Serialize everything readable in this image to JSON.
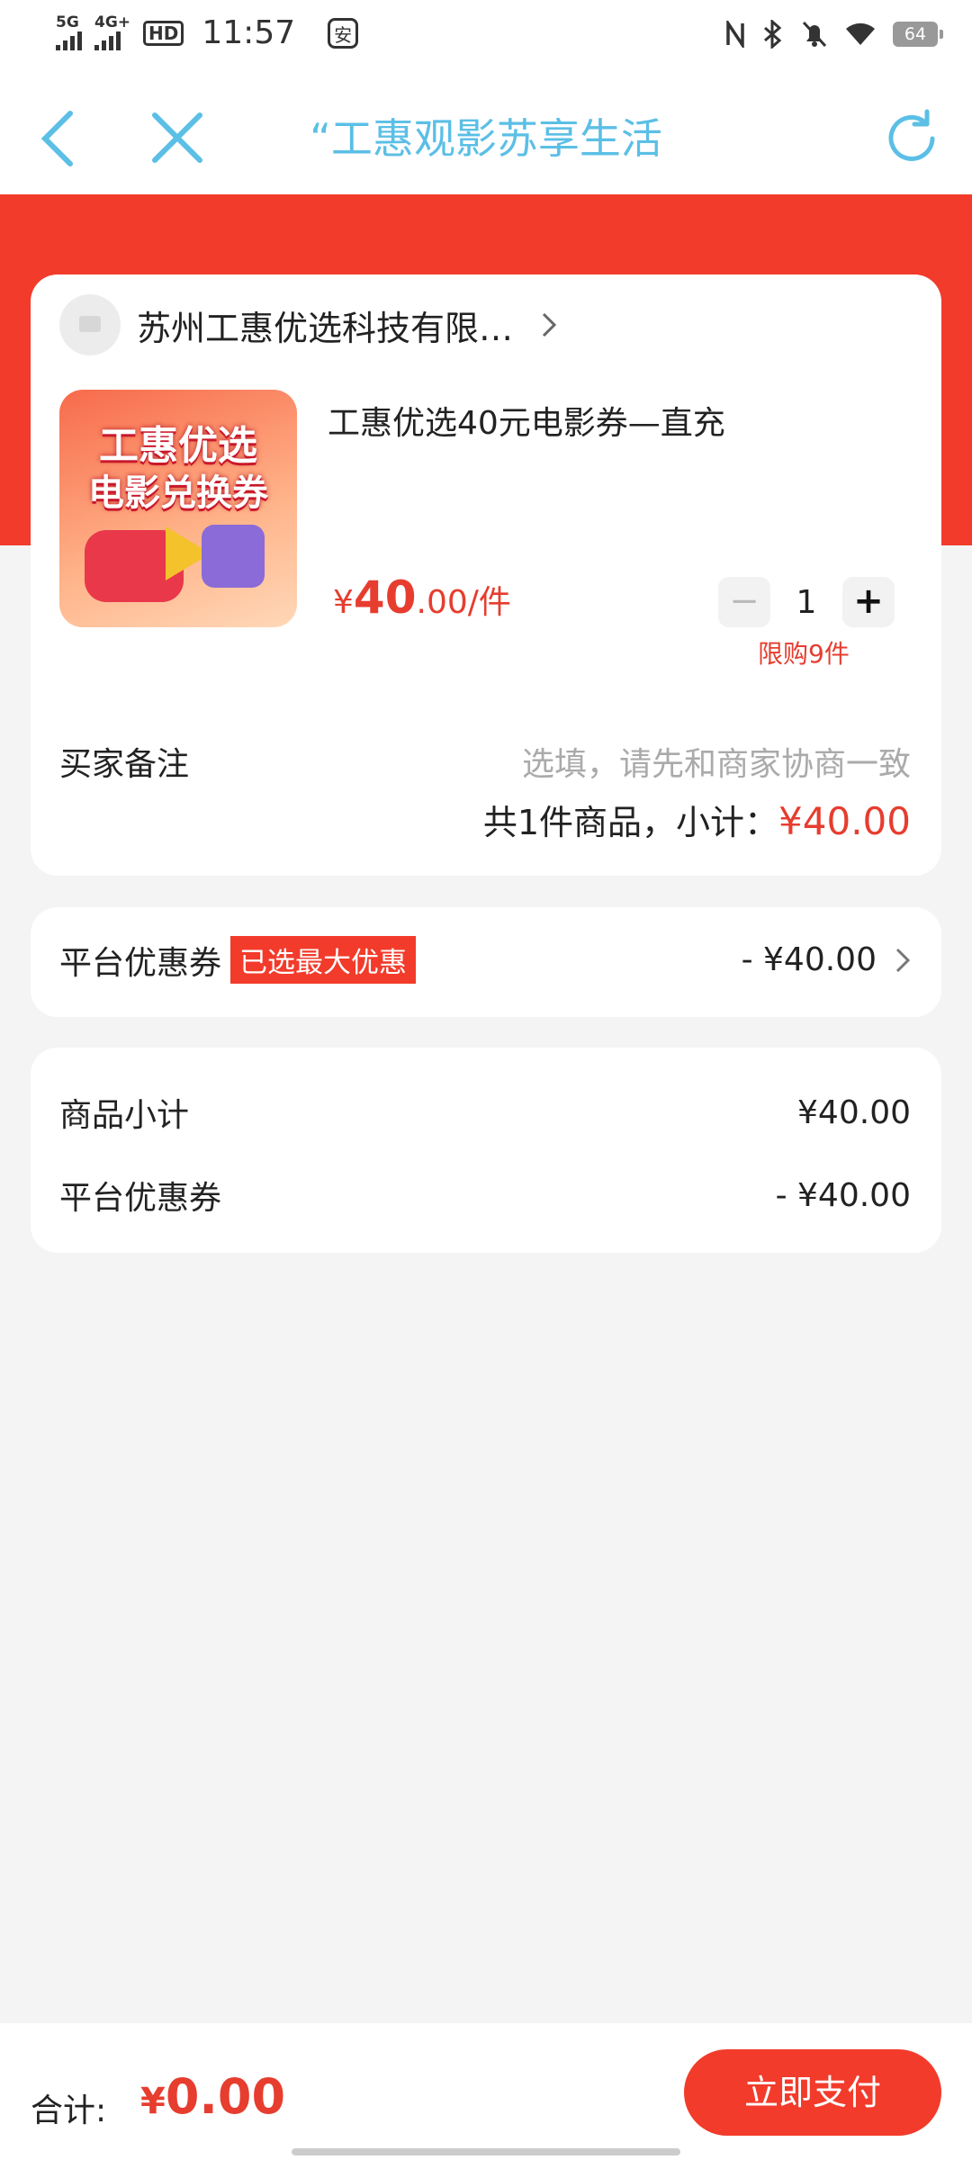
{
  "status_bar": {
    "net1": "5G",
    "net2": "4G+",
    "hd": "HD",
    "time": "11:57",
    "app_glyph": "安",
    "battery": "64"
  },
  "nav": {
    "title": "“工惠观影苏享生活",
    "icons": {
      "back": "chevron-left-icon",
      "close": "close-icon",
      "refresh": "refresh-icon"
    },
    "accent": "#5bbfe6"
  },
  "order": {
    "shop_name": "苏州工惠优选科技有限…",
    "product": {
      "title": "工惠优选40元电影券—直充",
      "image_text_line1": "工惠优选",
      "image_text_line2": "电影兑换券",
      "price_currency": "¥",
      "price_int": "40",
      "price_dec": ".00/件",
      "quantity": "1",
      "minus": "−",
      "plus": "+",
      "limit": "限购9件"
    },
    "remark_label": "买家备注",
    "remark_placeholder": "选填，请先和商家协商一致",
    "subtotal_prefix": "共1件商品，小计：",
    "subtotal_amount": "¥40.00"
  },
  "coupon": {
    "label": "平台优惠券",
    "badge": "已选最大优惠",
    "value": "- ¥40.00"
  },
  "summary": {
    "items": [
      {
        "label": "商品小计",
        "value": "¥40.00"
      },
      {
        "label": "平台优惠券",
        "value": "- ¥40.00"
      }
    ]
  },
  "footer": {
    "total_label": "合计:",
    "total_currency": "¥",
    "total_value": "0.00",
    "pay_button": "立即支付"
  },
  "colors": {
    "brand_red": "#f23b2b",
    "price_red": "#e63d2f"
  }
}
